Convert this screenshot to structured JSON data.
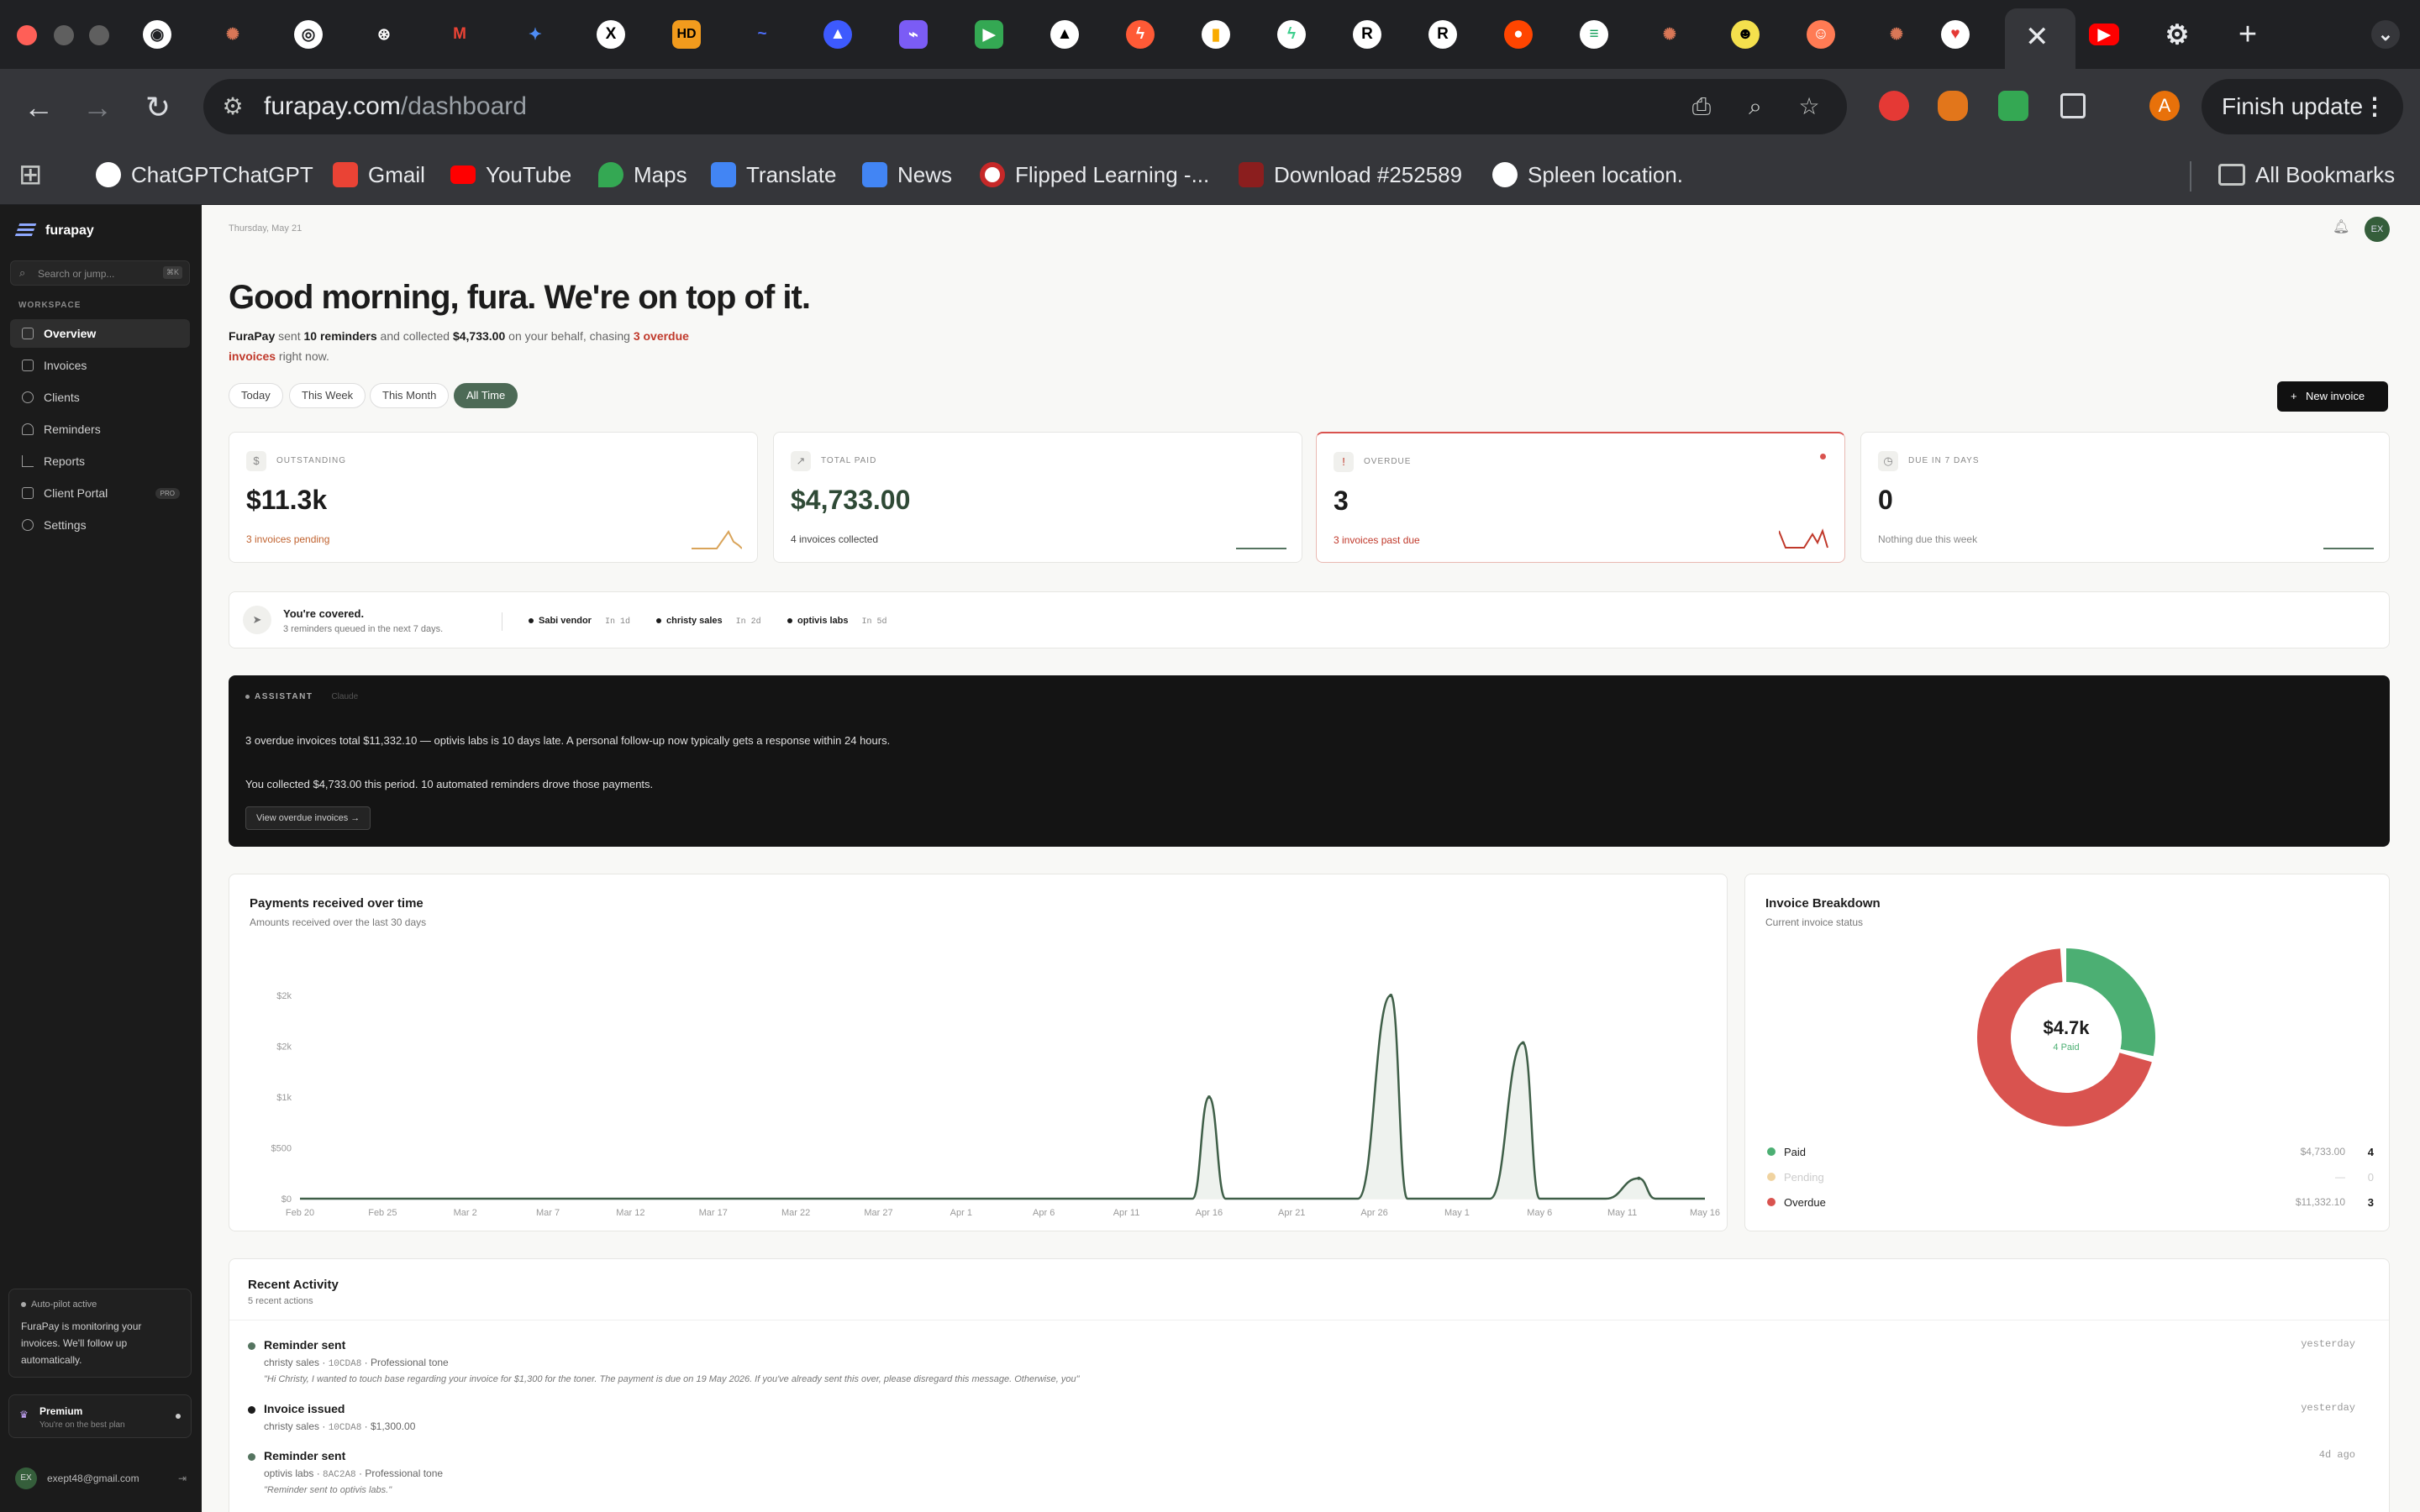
{
  "browser": {
    "url_host": "furapay.com",
    "url_path": "/dashboard",
    "finish_update": "Finish update",
    "profile_initial": "A",
    "bookmarks": [
      "ChatGPTChatGPT",
      "Gmail",
      "YouTube",
      "Maps",
      "Translate",
      "News",
      "Flipped Learning -...",
      "Download #252589",
      "Spleen location."
    ],
    "all_bookmarks": "All Bookmarks"
  },
  "sidebar": {
    "brand": "furapay",
    "search_placeholder": "Search or jump...",
    "search_shortcut": "⌘K",
    "section": "WORKSPACE",
    "items": [
      {
        "label": "Overview",
        "icon": "grid-icon"
      },
      {
        "label": "Invoices",
        "icon": "file-icon"
      },
      {
        "label": "Clients",
        "icon": "users-icon"
      },
      {
        "label": "Reminders",
        "icon": "bell-icon"
      },
      {
        "label": "Reports",
        "icon": "bar-chart-icon"
      },
      {
        "label": "Client Portal",
        "icon": "external-link-icon",
        "badge": "PRO"
      },
      {
        "label": "Settings",
        "icon": "gear-icon"
      }
    ],
    "autopilot_title": "Auto-pilot active",
    "autopilot_text": "FuraPay is monitoring your invoices. We'll follow up automatically.",
    "premium_title": "Premium",
    "premium_sub": "You're on the best plan",
    "user_initials": "EX",
    "user_email": "exept48@gmail.com"
  },
  "header": {
    "date": "Thursday, May 21",
    "avatar": "EX"
  },
  "hero": {
    "greeting": "Good morning, fura. We're on top of it.",
    "p1": "FuraPay",
    "p2": " sent ",
    "p3": "10 reminders",
    "p4": " and collected ",
    "p5": "$4,733.00",
    "p6": " on your behalf, chasing ",
    "p7": "3 overdue invoices",
    "p8": " right now."
  },
  "filters": [
    "Today",
    "This Week",
    "This Month",
    "All Time"
  ],
  "new_invoice": "New invoice",
  "stats": [
    {
      "label": "OUTSTANDING",
      "value": "$11.3k",
      "sub": "3 invoices pending",
      "icon": "$",
      "color": "#c0622f",
      "spark": "#d9a45a"
    },
    {
      "label": "TOTAL PAID",
      "value": "$4,733.00",
      "sub": "4 invoices collected",
      "icon": "↗",
      "color": "#444",
      "spark": "#557460"
    },
    {
      "label": "OVERDUE",
      "value": "3",
      "sub": "3 invoices past due",
      "icon": "!",
      "color": "#c0392b",
      "spark": "#c0392b"
    },
    {
      "label": "DUE IN 7 DAYS",
      "value": "0",
      "sub": "Nothing due this week",
      "icon": "◷",
      "color": "#888",
      "spark": "#557460"
    }
  ],
  "coverage": {
    "title": "You're covered.",
    "sub": "3 reminders queued in the next 7 days.",
    "queue": [
      {
        "name": "Sabi vendor",
        "when": "In 1d"
      },
      {
        "name": "christy sales",
        "when": "In 2d"
      },
      {
        "name": "optivis labs",
        "when": "In 5d"
      }
    ]
  },
  "assistant": {
    "label": "ASSISTANT",
    "model": "Claude",
    "line1": "3 overdue invoices total $11,332.10 — optivis labs is 10 days late. A personal follow-up now typically gets a response within 24 hours.",
    "line2": "You collected $4,733.00 this period. 10 automated reminders drove those payments.",
    "button": "View overdue invoices →"
  },
  "payments_chart": {
    "title": "Payments received over time",
    "subtitle": "Amounts received over the last 30 days"
  },
  "chart_data": {
    "type": "line",
    "title": "Payments received over time",
    "y_ticks": [
      "$0",
      "$500",
      "$1k",
      "$2k",
      "$2k"
    ],
    "x_ticks": [
      "Feb 20",
      "Feb 25",
      "Mar 2",
      "Mar 7",
      "Mar 12",
      "Mar 17",
      "Mar 22",
      "Mar 27",
      "Apr 1",
      "Apr 6",
      "Apr 11",
      "Apr 16",
      "Apr 21",
      "Apr 26",
      "May 1",
      "May 6",
      "May 11",
      "May 16"
    ],
    "ylim": [
      0,
      2000
    ],
    "points": [
      {
        "x": "Apr 14",
        "y": 0
      },
      {
        "x": "Apr 15",
        "y": 1000
      },
      {
        "x": "Apr 16",
        "y": 0
      },
      {
        "x": "Apr 24",
        "y": 0
      },
      {
        "x": "Apr 26",
        "y": 2000
      },
      {
        "x": "Apr 27",
        "y": 0
      },
      {
        "x": "May 2",
        "y": 0
      },
      {
        "x": "May 4",
        "y": 1533
      },
      {
        "x": "May 5",
        "y": 0
      },
      {
        "x": "May 9",
        "y": 0
      },
      {
        "x": "May 11",
        "y": 200
      },
      {
        "x": "May 12",
        "y": 0
      }
    ]
  },
  "breakdown": {
    "title": "Invoice Breakdown",
    "subtitle": "Current invoice status",
    "center_value": "$4.7k",
    "center_sub": "4 Paid",
    "rows": [
      {
        "label": "Paid",
        "amount": "$4,733.00",
        "count": "4",
        "color": "#4caf73"
      },
      {
        "label": "Pending",
        "amount": "—",
        "count": "0",
        "color": "#f0d3a0"
      },
      {
        "label": "Overdue",
        "amount": "$11,332.10",
        "count": "3",
        "color": "#d9534f"
      }
    ],
    "donut": {
      "paid": 4733.0,
      "overdue": 11332.1
    }
  },
  "activity": {
    "title": "Recent Activity",
    "sub": "5 recent actions",
    "items": [
      {
        "title": "Reminder sent",
        "client": "christy sales",
        "code": "10CDA8",
        "meta": "Professional tone",
        "quote": "\"Hi Christy, I wanted to touch base regarding your invoice for $1,300 for the toner. The payment is due on 19 May 2026. If you've already sent this over, please disregard this message. Otherwise, you\"",
        "time": "yesterday"
      },
      {
        "title": "Invoice issued",
        "client": "christy sales",
        "code": "10CDA8",
        "meta": "$1,300.00",
        "quote": "",
        "time": "yesterday"
      },
      {
        "title": "Reminder sent",
        "client": "optivis labs",
        "code": "8AC2A8",
        "meta": "Professional tone",
        "quote": "\"Reminder sent to optivis labs.\"",
        "time": "4d ago"
      }
    ]
  }
}
